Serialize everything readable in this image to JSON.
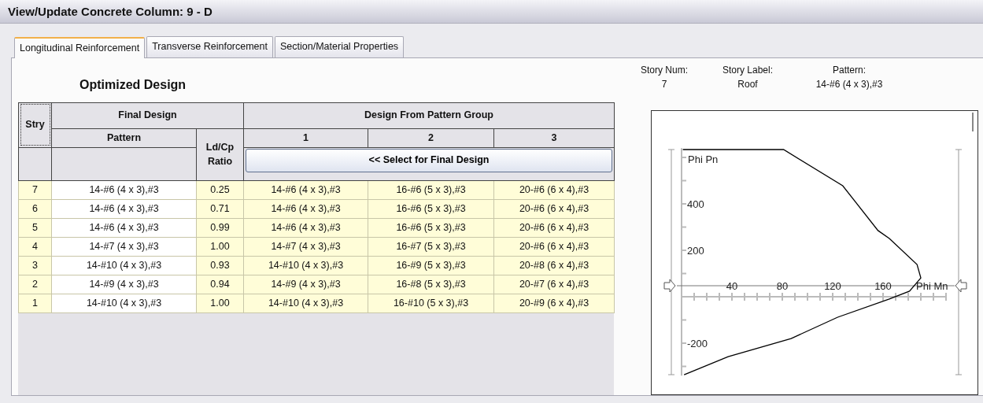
{
  "window": {
    "title": "View/Update Concrete Column:  9 - D"
  },
  "tabs": [
    {
      "label": "Longitudinal Reinforcement",
      "selected": true
    },
    {
      "label": "Transverse Reinforcement",
      "selected": false
    },
    {
      "label": "Section/Material Properties",
      "selected": false
    }
  ],
  "heading": "Optimized Design",
  "story_info": [
    {
      "label": "Story Num:",
      "value": "7"
    },
    {
      "label": "Story Label:",
      "value": "Roof"
    },
    {
      "label": "Pattern:",
      "value": "14-#6 (4 x 3),#3"
    }
  ],
  "table": {
    "stry_header": "Stry",
    "final_header": "Final Design",
    "group_header": "Design From Pattern Group",
    "pattern_header": "Pattern",
    "ratio_header": "Ld/Cp Ratio",
    "group_columns": [
      "1",
      "2",
      "3"
    ],
    "select_button": "<< Select for Final Design",
    "rows": [
      [
        "7",
        "14-#6 (4 x 3),#3",
        "0.25",
        "14-#6 (4 x 3),#3",
        "16-#6 (5 x 3),#3",
        "20-#6 (6 x 4),#3"
      ],
      [
        "6",
        "14-#6 (4 x 3),#3",
        "0.71",
        "14-#6 (4 x 3),#3",
        "16-#6 (5 x 3),#3",
        "20-#6 (6 x 4),#3"
      ],
      [
        "5",
        "14-#6 (4 x 3),#3",
        "0.99",
        "14-#6 (4 x 3),#3",
        "16-#6 (5 x 3),#3",
        "20-#6 (6 x 4),#3"
      ],
      [
        "4",
        "14-#7 (4 x 3),#3",
        "1.00",
        "14-#7 (4 x 3),#3",
        "16-#7 (5 x 3),#3",
        "20-#6 (6 x 4),#3"
      ],
      [
        "3",
        "14-#10 (4 x 3),#3",
        "0.93",
        "14-#10 (4 x 3),#3",
        "16-#9 (5 x 3),#3",
        "20-#8 (6 x 4),#3"
      ],
      [
        "2",
        "14-#9 (4 x 3),#3",
        "0.94",
        "14-#9 (4 x 3),#3",
        "16-#8 (5 x 3),#3",
        "20-#7 (6 x 4),#3"
      ],
      [
        "1",
        "14-#10 (4 x 3),#3",
        "1.00",
        "14-#10 (4 x 3),#3",
        "16-#10 (5 x 3),#3",
        "20-#9 (6 x 4),#3"
      ]
    ]
  },
  "chart_data": {
    "type": "line",
    "xlabel": "Phi Mn",
    "ylabel": "Phi Pn",
    "xticks": [
      40,
      80,
      120,
      160
    ],
    "yticks": [
      -200,
      200,
      400
    ],
    "xlim": [
      0,
      210
    ],
    "ylim": [
      -340,
      640
    ],
    "x": [
      1,
      81,
      128,
      156,
      165,
      187,
      190,
      181,
      165,
      124,
      87,
      37,
      2
    ],
    "series": [
      {
        "color": "#000000",
        "values": [
          634,
          634,
          478,
          285,
          251,
          139,
          81,
          24,
          -10,
          -88,
          -180,
          -258,
          -336
        ]
      }
    ]
  }
}
